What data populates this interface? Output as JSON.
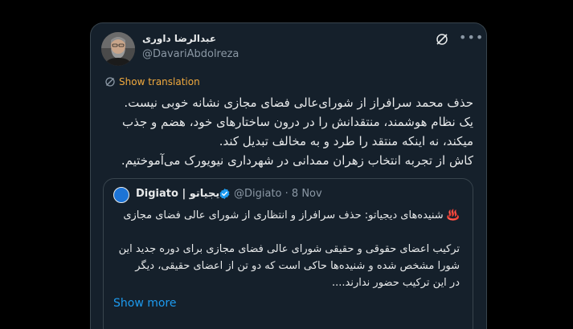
{
  "tweet": {
    "author_name": "عبدالرضا داوری",
    "author_handle": "@DavariAbdolreza",
    "show_translation": "Show translation",
    "body_lines": [
      "حذف محمد سرافراز از شورای‌عالی فضای مجازی نشانه خوبی نیست.",
      "یک نظام هوشمند، منتقدانش را در درون ساختارهای خود، هضم و جذب",
      "میکند، نه اینکه منتقد را طرد و به مخالف تبدیل کند.",
      "کاش از تجربه انتخاب زهران ممدانی در شهرداری نیویورک می‌آموختیم."
    ],
    "icons": {
      "grok": "grok-icon",
      "more": "more-icon",
      "translate": "translate-icon"
    }
  },
  "quote": {
    "name_en": "Digiato",
    "name_fa": "دیجیاتو",
    "separator": "|",
    "handle": "@Digiato",
    "date": "8 Nov",
    "line1": "♨️ شنیده‌های دیجیاتو: حذف سرافراز و انتظاری از شورای عالی فضای مجازی",
    "line2": "ترکیب اعضای حقوقی و حقیقی شورای عالی فضای مجازی برای دوره جدید این",
    "line3": "شورا مشخص شده و شنیده‌ها حاکی است که دو تن از اعضای حقیقی، دیگر",
    "line4": "در این ترکیب حضور ندارند....",
    "show_more": "Show more",
    "icons": {
      "avatar": "digiato-logo-icon",
      "badge": "verified-badge-icon"
    }
  },
  "colors": {
    "background": "#15202b",
    "text": "#e7e9ea",
    "muted": "#8b98a5",
    "link": "#1d9bf0",
    "translation": "#f0a93e",
    "verified": "#1d9bf0"
  }
}
